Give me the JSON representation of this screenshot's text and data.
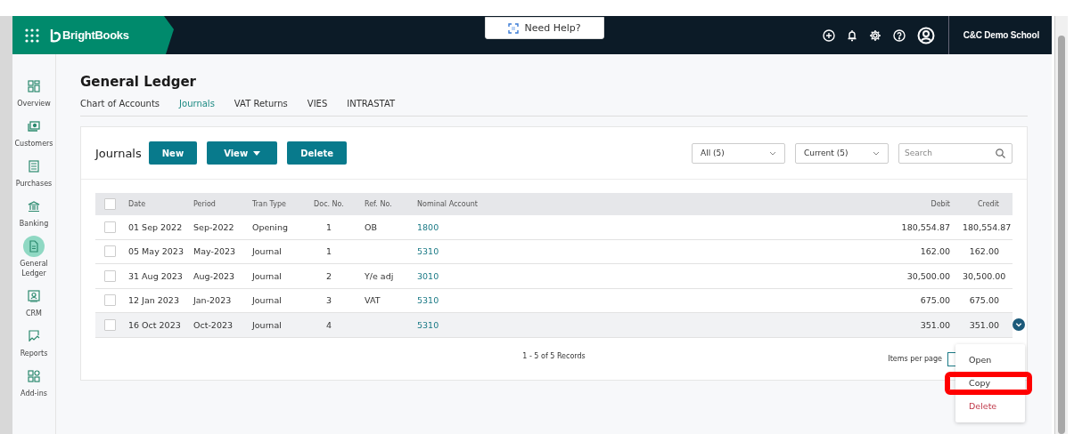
{
  "header": {
    "brand": "BrightBooks",
    "help": "Need Help?",
    "company": "C&C Demo School"
  },
  "sidebar": {
    "items": [
      {
        "label": "Overview",
        "selected": false
      },
      {
        "label": "Customers",
        "selected": false
      },
      {
        "label": "Purchases",
        "selected": false
      },
      {
        "label": "Banking",
        "selected": false
      },
      {
        "label": "General Ledger",
        "selected": true
      },
      {
        "label": "CRM",
        "selected": false
      },
      {
        "label": "Reports",
        "selected": false
      },
      {
        "label": "Add-ins",
        "selected": false
      }
    ]
  },
  "page": {
    "title": "General Ledger",
    "tabs": [
      {
        "label": "Chart of Accounts",
        "selected": false
      },
      {
        "label": "Journals",
        "selected": true
      },
      {
        "label": "VAT Returns",
        "selected": false
      },
      {
        "label": "VIES",
        "selected": false
      },
      {
        "label": "INTRASTAT",
        "selected": false
      }
    ]
  },
  "card": {
    "title": "Journals",
    "buttons": [
      {
        "label": "New",
        "kind": "plain"
      },
      {
        "label": "View",
        "kind": "dropdown"
      },
      {
        "label": "Delete",
        "kind": "plain"
      }
    ],
    "filters": [
      {
        "value": "All (5)"
      },
      {
        "value": "Current (5)"
      }
    ],
    "search": {
      "placeholder": "Search"
    }
  },
  "table": {
    "all_checked": false,
    "columns": [
      "Date",
      "Period",
      "Tran Type",
      "Doc. No.",
      "Ref. No.",
      "Nominal Account",
      "Debit",
      "Credit"
    ],
    "rows": [
      {
        "checked": false,
        "selected": false,
        "cells": [
          "01 Sep 2022",
          "Sep-2022",
          "Opening",
          "1",
          "OB",
          "1800",
          "180,554.87",
          "180,554.87"
        ]
      },
      {
        "checked": false,
        "selected": false,
        "cells": [
          "05 May 2023",
          "May-2023",
          "Journal",
          "1",
          "",
          "5310",
          "162.00",
          "162.00"
        ]
      },
      {
        "checked": false,
        "selected": false,
        "cells": [
          "31 Aug 2023",
          "Aug-2023",
          "Journal",
          "2",
          "Y/e adj",
          "3010",
          "30,500.00",
          "30,500.00"
        ]
      },
      {
        "checked": false,
        "selected": false,
        "cells": [
          "12 Jan 2023",
          "Jan-2023",
          "Journal",
          "3",
          "VAT",
          "5310",
          "675.00",
          "675.00"
        ]
      },
      {
        "checked": false,
        "selected": true,
        "cells": [
          "16 Oct 2023",
          "Oct-2023",
          "Journal",
          "4",
          "",
          "5310",
          "351.00",
          "351.00"
        ]
      }
    ],
    "records": "1 - 5 of 5 Records",
    "items_per_page": "Items per page"
  },
  "row_menu": {
    "items": [
      {
        "label": "Open",
        "kind": "normal",
        "highlighted": false
      },
      {
        "label": "Copy",
        "kind": "normal",
        "highlighted": true
      },
      {
        "label": "Delete",
        "kind": "danger",
        "highlighted": false
      }
    ]
  }
}
